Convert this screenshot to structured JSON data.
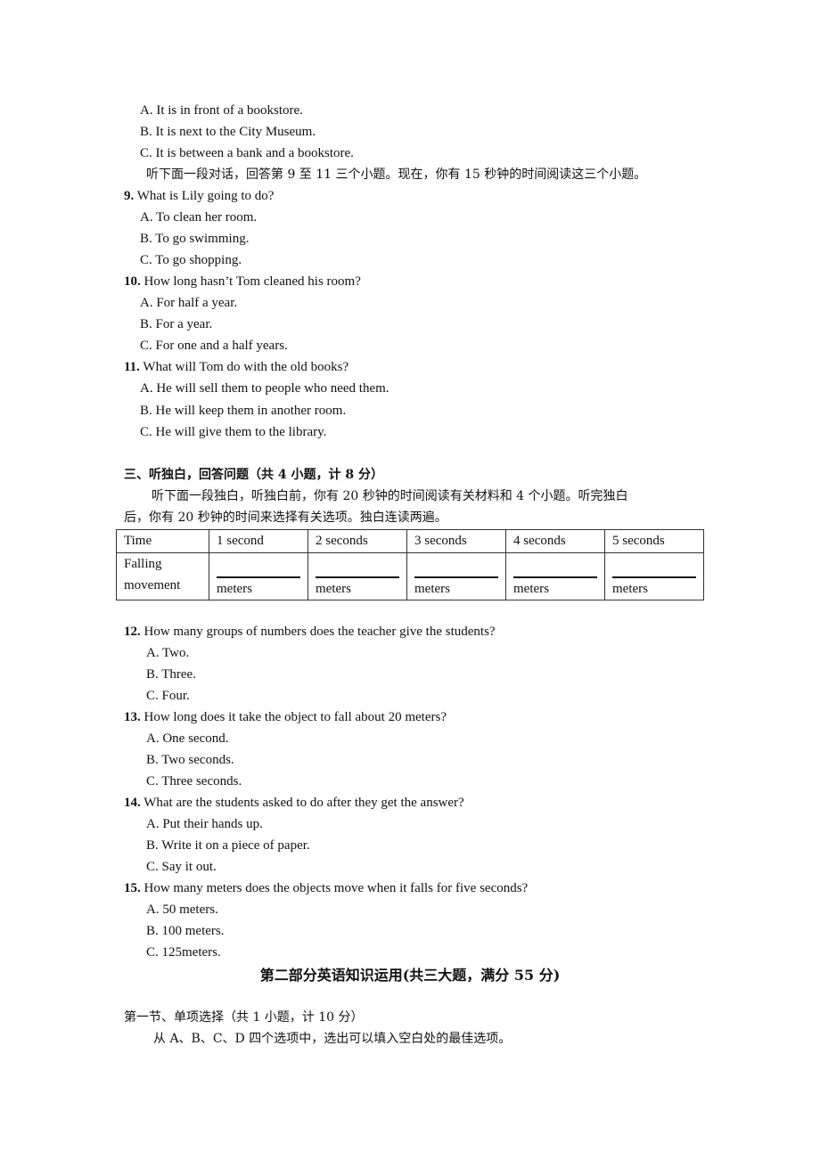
{
  "q8_options": [
    "A. It is in front of a bookstore.",
    "B. It is next to the City Museum.",
    "C. It is between a bank and a bookstore."
  ],
  "dialogue_instruction": "听下面一段对话，回答第 9 至 11 三个小题。现在，你有 15 秒钟的时间阅读这三个小题。",
  "questions_9_11": [
    {
      "number": "9.",
      "text": "What is Lily going to do?",
      "options": [
        "A. To clean her room.",
        "B. To go swimming.",
        "C. To go shopping."
      ]
    },
    {
      "number": "10.",
      "text": "How long hasn’t Tom cleaned his room?",
      "options": [
        "A. For half a year.",
        "B. For a year.",
        "C. For one and a half years."
      ]
    },
    {
      "number": "11.",
      "text": "What will Tom do with the old books?",
      "options": [
        "A. He will sell them to people who need them.",
        "B. He will keep them in another room.",
        "C. He will give them to the library."
      ]
    }
  ],
  "section3": {
    "heading": "三、听独白，回答问题（共 4 小题，计 8 分）",
    "instruction_line1": "听下面一段独白，听独白前，你有 20 秒钟的时间阅读有关材料和 4 个小题。听完独白",
    "instruction_line2": "后，你有 20 秒钟的时间来选择有关选项。独白连读两遍。"
  },
  "table": {
    "header_label": "Time",
    "columns": [
      "1 second",
      "2 seconds",
      "3 seconds",
      "4 seconds",
      "5 seconds"
    ],
    "row_label_line1": "Falling",
    "row_label_line2": "movement",
    "unit": "meters"
  },
  "questions_12_15": [
    {
      "number": "12.",
      "text": "How many groups of numbers does the teacher give the students?",
      "options": [
        "A. Two.",
        "B. Three.",
        "C. Four."
      ]
    },
    {
      "number": "13.",
      "text": "How long does it take the object to fall about 20 meters?",
      "options": [
        "A. One second.",
        "B. Two seconds.",
        "C. Three seconds."
      ]
    },
    {
      "number": "14.",
      "text": "What are the students asked to do after they get the answer?",
      "options": [
        "A. Put their hands up.",
        "B. Write it on a piece of paper.",
        "C. Say it out."
      ]
    },
    {
      "number": "15.",
      "text": "How many meters does the objects move when it falls for five seconds?",
      "options": [
        "A. 50 meters.",
        "B. 100 meters.",
        "C. 125meters."
      ]
    }
  ],
  "part2": {
    "title": "第二部分英语知识运用(共三大题，满分 55 分)",
    "section1_heading": "第一节、单项选择（共 1 小题，计 10 分）",
    "section1_instruction": "从 A、B、C、D 四个选项中，选出可以填入空白处的最佳选项。"
  }
}
